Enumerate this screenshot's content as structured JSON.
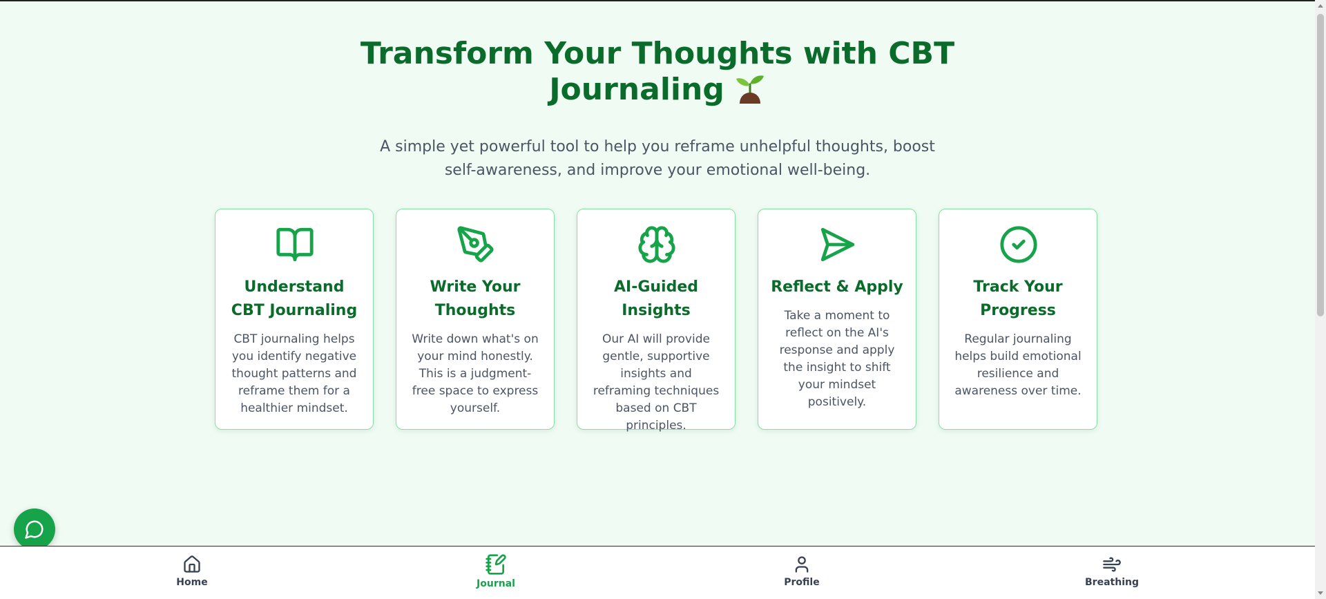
{
  "hero": {
    "title_line1": "Transform Your Thoughts with CBT",
    "title_line2": "Journaling",
    "title_emoji": "sprout-icon",
    "subtitle": "A simple yet powerful tool to help you reframe unhelpful thoughts, boost self-awareness, and improve your emotional well-being."
  },
  "cards": [
    {
      "icon": "book-open-icon",
      "title": "Understand CBT Journaling",
      "text": "CBT journaling helps you identify negative thought patterns and reframe them for a healthier mindset."
    },
    {
      "icon": "pen-tool-icon",
      "title": "Write Your Thoughts",
      "text": "Write down what's on your mind honestly. This is a judgment-free space to express yourself."
    },
    {
      "icon": "brain-icon",
      "title": "AI-Guided Insights",
      "text": "Our AI will provide gentle, supportive insights and reframing techniques based on CBT principles."
    },
    {
      "icon": "send-icon",
      "title": "Reflect & Apply",
      "text": "Take a moment to reflect on the AI's response and apply the insight to shift your mindset positively."
    },
    {
      "icon": "check-circle-icon",
      "title": "Track Your Progress",
      "text": "Regular journaling helps build emotional resilience and awareness over time."
    }
  ],
  "chat_button": {
    "icon": "message-circle-icon"
  },
  "bottom_nav": {
    "items": [
      {
        "icon": "home-icon",
        "label": "Home",
        "active": false
      },
      {
        "icon": "notebook-pen-icon",
        "label": "Journal",
        "active": true
      },
      {
        "icon": "user-icon",
        "label": "Profile",
        "active": false
      },
      {
        "icon": "wind-icon",
        "label": "Breathing",
        "active": false
      }
    ]
  },
  "colors": {
    "background": "#effbf3",
    "primary": "#16a34a",
    "heading": "#0b6b2b",
    "card_border": "#86e0a3",
    "body_text": "#4b5563"
  }
}
